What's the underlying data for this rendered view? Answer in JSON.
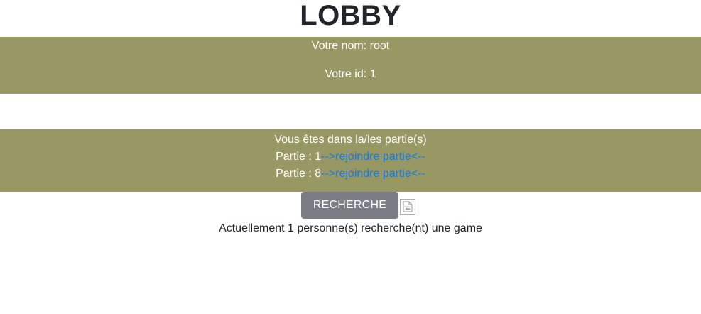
{
  "page": {
    "title": "LOBBY"
  },
  "user": {
    "name_line": "Votre nom: root",
    "id_line": "Votre id: 1"
  },
  "games": {
    "heading": "Vous êtes dans la/les partie(s)",
    "items": [
      {
        "label": "Partie : 1",
        "link": "-->rejoindre partie<--"
      },
      {
        "label": "Partie : 8",
        "link": "-->rejoindre partie<--"
      }
    ]
  },
  "search": {
    "button_label": "RECHERCHE",
    "status_text": "Actuellement 1 personne(s) recherche(nt) une game",
    "image_icon": "broken-image-icon"
  },
  "colors": {
    "band": "#989865",
    "button": "#7a7e84",
    "link": "#1a7ad8"
  }
}
